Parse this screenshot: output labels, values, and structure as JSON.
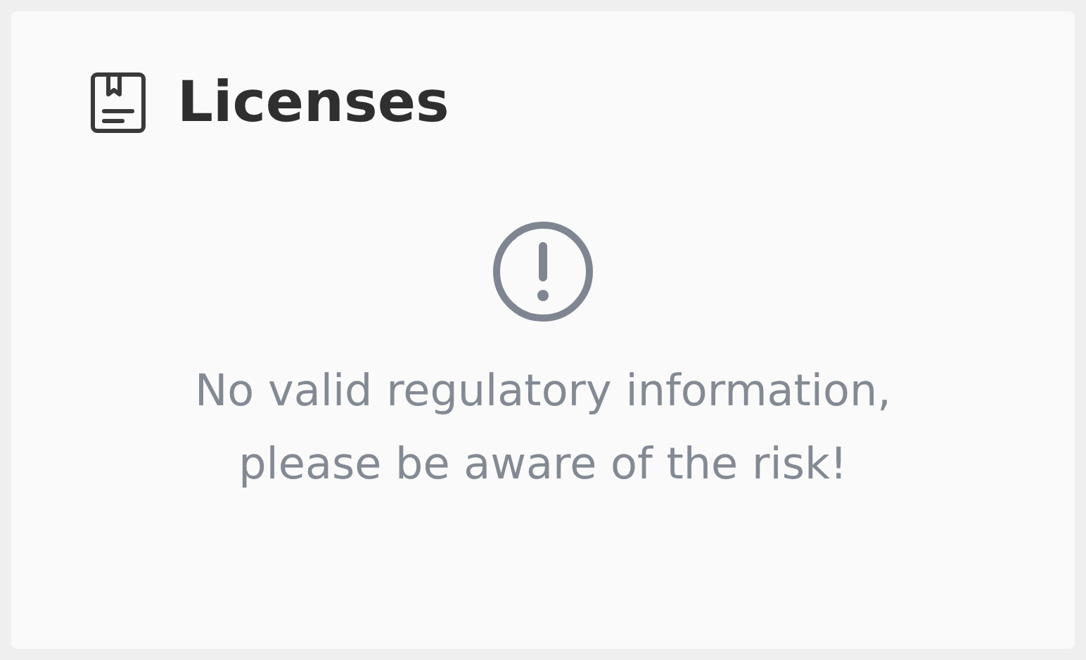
{
  "card": {
    "title": "Licenses",
    "notice": {
      "kind": "warning",
      "message": "No valid regulatory information, please be aware of the risk!"
    }
  }
}
